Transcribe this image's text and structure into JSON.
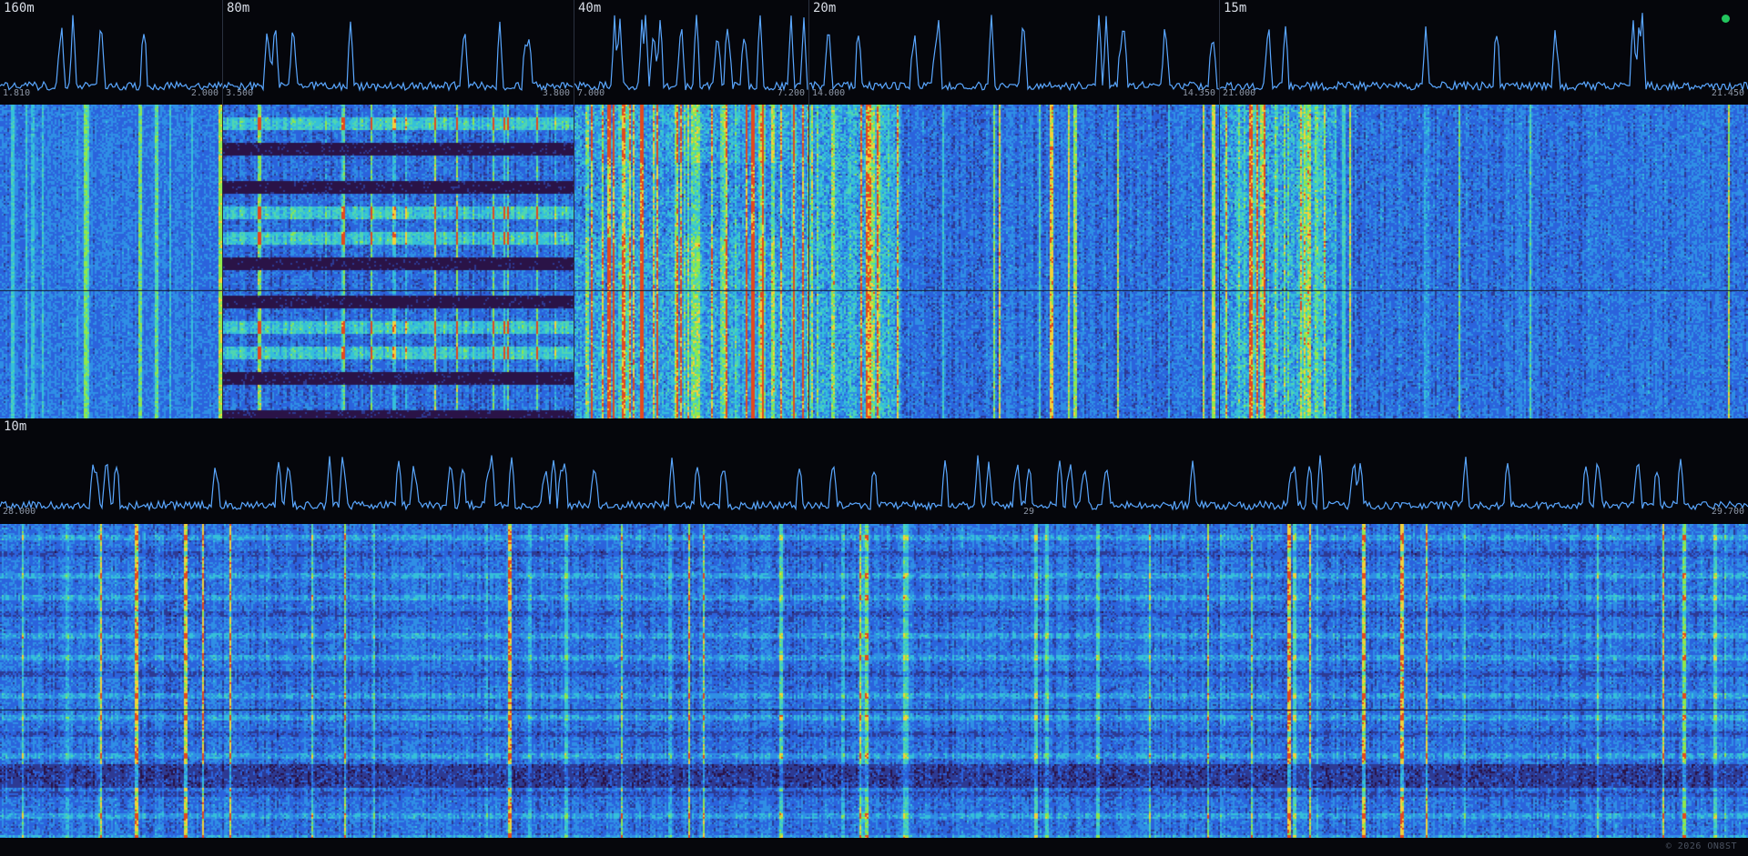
{
  "status": {
    "indicator": "status-dot",
    "color": "#22c55e"
  },
  "palette": {
    "background": "#06070c",
    "noise_floor": "#2b63dc",
    "weak": "#35c0d9",
    "medium": "#8ee84d",
    "strong": "#f3d13a",
    "very_strong": "#e34a1d",
    "empty": "#2a1347",
    "trace": "#5aa7ff"
  },
  "top_bands": [
    {
      "label": "160m",
      "freq_start": "1.810",
      "freq_end": "2.000",
      "activity": "low",
      "waterfall_pattern": "vertical-noise"
    },
    {
      "label": "80m",
      "freq_start": "3.500",
      "freq_end": "3.800",
      "activity": "medium",
      "waterfall_pattern": "horizontal-bands"
    },
    {
      "label": "40m",
      "freq_start": "7.000",
      "freq_end": "7.200",
      "activity": "very-high",
      "waterfall_pattern": "dense-mixed"
    },
    {
      "label": "20m",
      "freq_start": "14.000",
      "freq_end": "14.350",
      "activity": "high",
      "waterfall_pattern": "left-heavy"
    },
    {
      "label": "15m",
      "freq_start": "21.000",
      "freq_end": "21.450",
      "activity": "medium",
      "waterfall_pattern": "left-heavy"
    }
  ],
  "bottom_band": {
    "label": "10m",
    "freq_start": "28.000",
    "freq_mid": "29",
    "freq_end": "29.700",
    "activity": "carriers",
    "waterfall_pattern": "carriers-grid"
  },
  "footer": {
    "copyright": "© 2026 ON8ST"
  }
}
